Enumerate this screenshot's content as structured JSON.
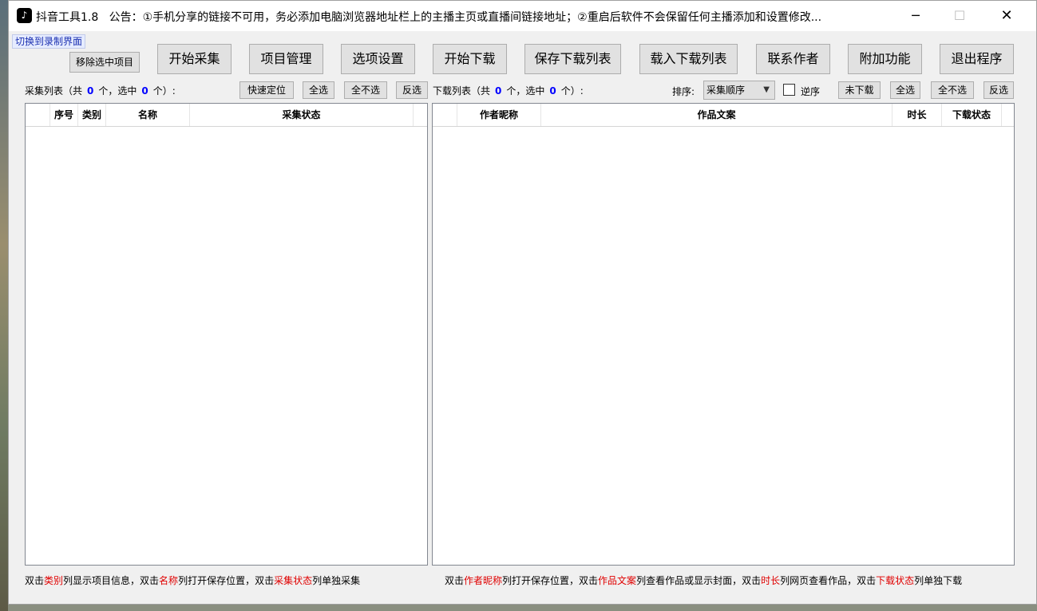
{
  "window": {
    "app_icon": "douyin-logo-icon",
    "title": "抖音工具1.8",
    "announcement": "公告：①手机分享的链接不可用，务必添加电脑浏览器地址栏上的主播主页或直播间链接地址；②重启后软件不会保留任何主播添加和设置修改...",
    "minimize": "─",
    "maximize": "☐",
    "close": "✕"
  },
  "switch_link": "切换到录制界面",
  "toolbar": {
    "remove_selected": "移除选中项目",
    "start_collect": "开始采集",
    "project_manage": "项目管理",
    "options": "选项设置",
    "start_download": "开始下载",
    "save_list": "保存下载列表",
    "load_list": "载入下载列表",
    "contact": "联系作者",
    "extras": "附加功能",
    "exit": "退出程序"
  },
  "collect": {
    "label_prefix": "采集列表（共",
    "total": "0",
    "label_mid": "个，选中",
    "selected": "0",
    "label_suffix": "个）:",
    "quick_locate": "快速定位",
    "select_all": "全选",
    "select_none": "全不选",
    "invert": "反选",
    "columns": [
      "",
      "序号",
      "类别",
      "名称",
      "采集状态",
      ""
    ]
  },
  "download": {
    "label_prefix": "下载列表（共",
    "total": "0",
    "label_mid": "个，选中",
    "selected": "0",
    "label_suffix": "个）:",
    "sort_label": "排序:",
    "sort_value": "采集顺序",
    "reverse_label": "逆序",
    "reverse_checked": false,
    "not_downloaded": "未下载",
    "select_all": "全选",
    "select_none": "全不选",
    "invert": "反选",
    "columns": [
      "",
      "作者昵称",
      "作品文案",
      "时长",
      "下载状态",
      ""
    ]
  },
  "hints": {
    "left": [
      "双击",
      "类别",
      "列显示项目信息，双击",
      "名称",
      "列打开保存位置，双击",
      "采集状态",
      "列单独采集"
    ],
    "right": [
      "双击",
      "作者昵称",
      "列打开保存位置，双击",
      "作品文案",
      "列查看作品或显示封面，双击",
      "时长",
      "列网页查看作品，双击",
      "下载状态",
      "列单独下载"
    ]
  },
  "colors": {
    "highlight": "#e00000",
    "count": "#0000ff"
  }
}
